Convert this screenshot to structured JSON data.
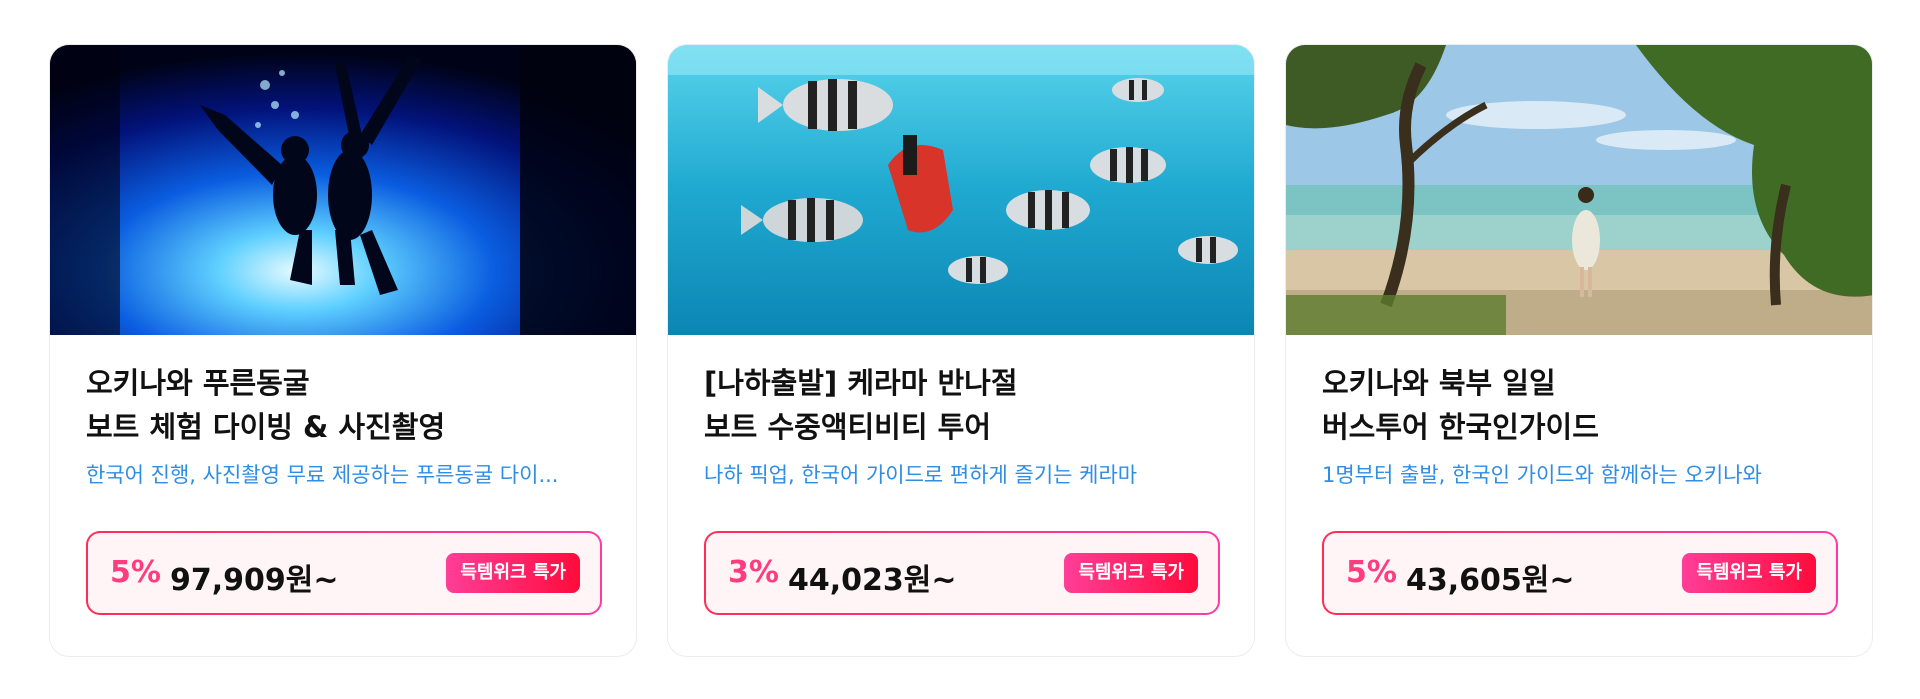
{
  "cards": [
    {
      "title_line1": "오키나와 푸른동굴",
      "title_line2": "보트 체험 다이빙 & 사진촬영",
      "description": "한국어 진행, 사진촬영 무료 제공하는 푸른동굴 다이...",
      "discount": "5%",
      "price": "97,909원~",
      "badge": "득템위크 특가",
      "image_icon": "scuba-divers-blue-cave-photo"
    },
    {
      "title_line1": "[나하출발] 케라마 반나절",
      "title_line2": "보트 수중액티비티 투어",
      "description": "나하 픽업, 한국어 가이드로 편하게 즐기는 케라마",
      "discount": "3%",
      "price": "44,023원~",
      "badge": "득템위크 특가",
      "image_icon": "snorkeling-with-striped-fish-photo"
    },
    {
      "title_line1": "오키나와 북부 일일",
      "title_line2": "버스투어 한국인가이드",
      "description": "1명부터 출발, 한국인 가이드와 함께하는 오키나와",
      "discount": "5%",
      "price": "43,605원~",
      "badge": "득템위크 특가",
      "image_icon": "beach-with-trees-woman-photo"
    }
  ],
  "colors": {
    "accent_pink": "#ff3c7f",
    "desc_blue": "#2f8de4",
    "badge_start": "#ff3e98",
    "badge_end": "#ff0b3c"
  }
}
